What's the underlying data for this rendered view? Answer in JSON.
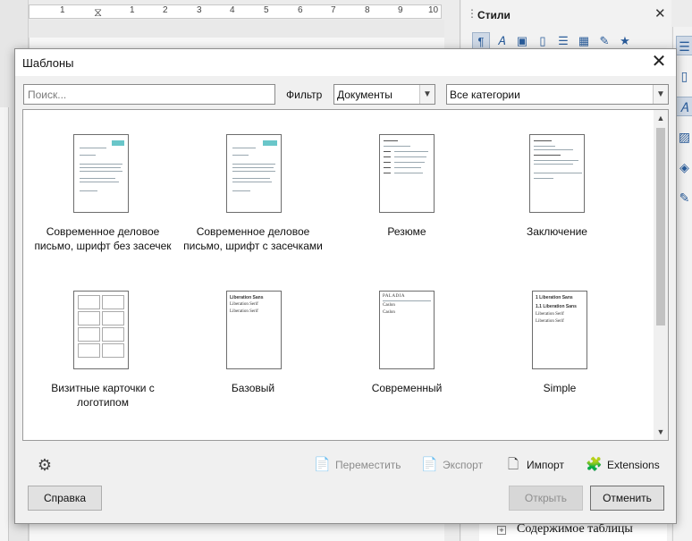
{
  "background": {
    "ruler_numbers": [
      "1",
      "1",
      "2",
      "3",
      "4",
      "5",
      "6",
      "7",
      "8",
      "9",
      "10"
    ],
    "styles_panel": {
      "title": "Стили",
      "bottom_item": "Содержимое таблицы",
      "toolbar_icons": [
        "paragraph-styles-icon",
        "character-styles-icon",
        "frame-styles-icon",
        "page-styles-icon",
        "list-styles-icon",
        "table-styles-icon",
        "fill-format-icon",
        "new-style-icon"
      ]
    }
  },
  "dialog": {
    "title": "Шаблоны",
    "search": {
      "placeholder": "Поиск...",
      "value": ""
    },
    "filter_label": "Фильтр",
    "filter_value": "Документы",
    "category_value": "Все категории",
    "templates": [
      {
        "label_lines": [
          "Современное деловое",
          "письмо, шрифт без засечек"
        ]
      },
      {
        "label_lines": [
          "Современное деловое",
          "письмо, шрифт с засечками"
        ]
      },
      {
        "label_lines": [
          "Резюме",
          ""
        ]
      },
      {
        "label_lines": [
          "Заключение",
          ""
        ]
      },
      {
        "label_lines": [
          "Визитные карточки с",
          "логотипом"
        ]
      },
      {
        "label_lines": [
          "Базовый",
          ""
        ]
      },
      {
        "label_lines": [
          "Современный",
          ""
        ]
      },
      {
        "label_lines": [
          "Simple",
          ""
        ]
      }
    ],
    "thumb_texts": {
      "basic": [
        "Liberation Sans",
        "Liberation Serif",
        "Liberation Serif"
      ],
      "modern": [
        "PALADIA",
        "Caslon",
        "Caslon"
      ],
      "simple": [
        "1    Liberation Sans",
        "1.1  Liberation Sans",
        "Liberation Serif",
        "Liberation Serif"
      ]
    },
    "actions": {
      "move": "Переместить",
      "export": "Экспорт",
      "import": "Импорт",
      "extensions": "Extensions"
    },
    "buttons": {
      "help": "Справка",
      "open": "Открыть",
      "cancel": "Отменить"
    }
  }
}
